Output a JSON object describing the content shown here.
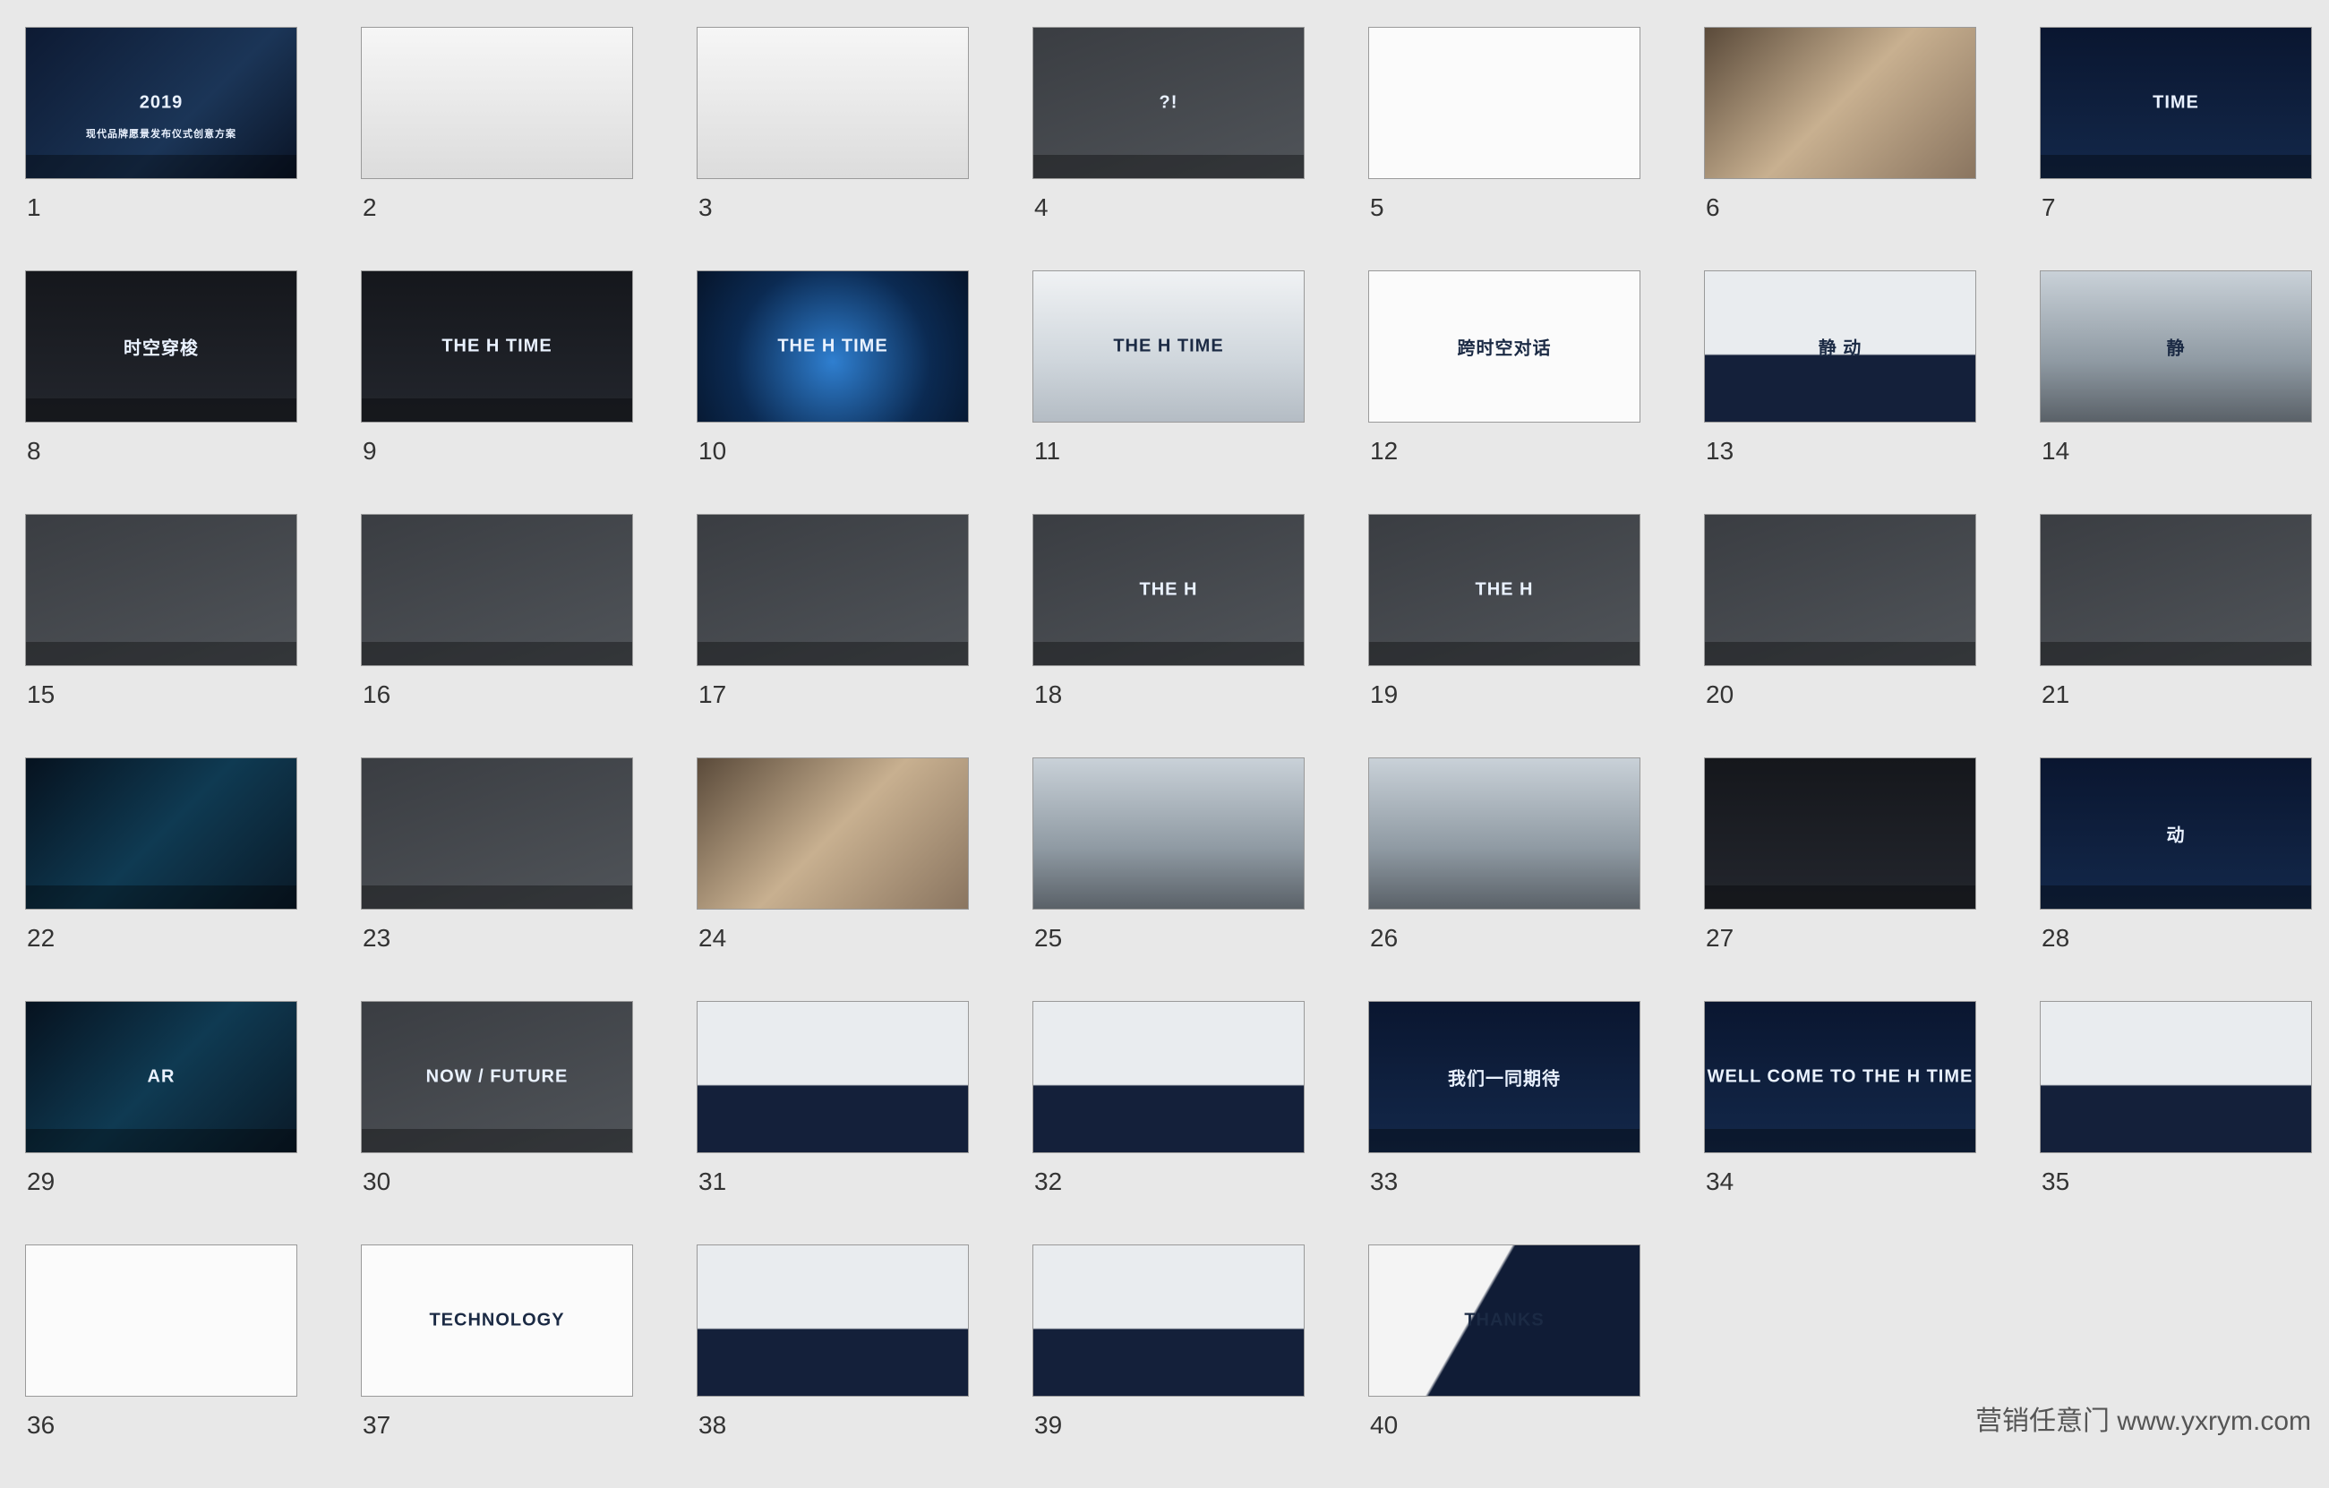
{
  "slides": [
    {
      "num": "1",
      "title": "2019",
      "subtitle": "现代品牌愿景发布仪式创意方案",
      "theme": "t-dark",
      "text_color": "light"
    },
    {
      "num": "2",
      "title": "",
      "theme": "t-light",
      "text_color": "dark"
    },
    {
      "num": "3",
      "title": "",
      "theme": "t-light",
      "text_color": "dark"
    },
    {
      "num": "4",
      "title": "?!",
      "theme": "t-gray",
      "text_color": "light"
    },
    {
      "num": "5",
      "title": "",
      "theme": "t-white",
      "text_color": "dark"
    },
    {
      "num": "6",
      "title": "",
      "theme": "t-warm",
      "text_color": "light"
    },
    {
      "num": "7",
      "title": "TIME",
      "theme": "t-navy",
      "text_color": "light"
    },
    {
      "num": "8",
      "title": "时空穿梭",
      "theme": "t-tunnel",
      "text_color": "light"
    },
    {
      "num": "9",
      "title": "THE H TIME",
      "theme": "t-tunnel",
      "text_color": "light"
    },
    {
      "num": "10",
      "title": "THE H TIME",
      "theme": "t-blue",
      "text_color": "light"
    },
    {
      "num": "11",
      "title": "THE H TIME",
      "theme": "t-sky",
      "text_color": "dark"
    },
    {
      "num": "12",
      "title": "跨时空对话",
      "theme": "t-white",
      "text_color": "dark"
    },
    {
      "num": "13",
      "title": "静 动",
      "theme": "t-wave",
      "text_color": "dark"
    },
    {
      "num": "14",
      "title": "静",
      "theme": "t-studio",
      "text_color": "dark"
    },
    {
      "num": "15",
      "title": "",
      "theme": "t-gray",
      "text_color": "light"
    },
    {
      "num": "16",
      "title": "",
      "theme": "t-gray",
      "text_color": "light"
    },
    {
      "num": "17",
      "title": "",
      "theme": "t-gray",
      "text_color": "light"
    },
    {
      "num": "18",
      "title": "THE H",
      "theme": "t-gray",
      "text_color": "light"
    },
    {
      "num": "19",
      "title": "THE H",
      "theme": "t-gray",
      "text_color": "light"
    },
    {
      "num": "20",
      "title": "",
      "theme": "t-gray",
      "text_color": "light"
    },
    {
      "num": "21",
      "title": "",
      "theme": "t-gray",
      "text_color": "light"
    },
    {
      "num": "22",
      "title": "",
      "theme": "t-cyan",
      "text_color": "light"
    },
    {
      "num": "23",
      "title": "",
      "theme": "t-gray",
      "text_color": "light"
    },
    {
      "num": "24",
      "title": "",
      "theme": "t-warm",
      "text_color": "light"
    },
    {
      "num": "25",
      "title": "",
      "theme": "t-studio",
      "text_color": "light"
    },
    {
      "num": "26",
      "title": "",
      "theme": "t-studio",
      "text_color": "light"
    },
    {
      "num": "27",
      "title": "",
      "theme": "t-tunnel",
      "text_color": "light"
    },
    {
      "num": "28",
      "title": "动",
      "theme": "t-navy",
      "text_color": "light"
    },
    {
      "num": "29",
      "title": "AR",
      "theme": "t-cyan",
      "text_color": "light"
    },
    {
      "num": "30",
      "title": "NOW / FUTURE",
      "theme": "t-gray",
      "text_color": "light"
    },
    {
      "num": "31",
      "title": "",
      "theme": "t-wave",
      "text_color": "dark"
    },
    {
      "num": "32",
      "title": "",
      "theme": "t-wave",
      "text_color": "dark"
    },
    {
      "num": "33",
      "title": "我们一同期待",
      "theme": "t-navy",
      "text_color": "light"
    },
    {
      "num": "34",
      "title": "WELL COME TO THE H TIME",
      "theme": "t-navy",
      "text_color": "light"
    },
    {
      "num": "35",
      "title": "",
      "theme": "t-wave",
      "text_color": "dark"
    },
    {
      "num": "36",
      "title": "",
      "theme": "t-white",
      "text_color": "dark"
    },
    {
      "num": "37",
      "title": "TECHNOLOGY",
      "theme": "t-white",
      "text_color": "dark"
    },
    {
      "num": "38",
      "title": "",
      "theme": "t-wave",
      "text_color": "dark"
    },
    {
      "num": "39",
      "title": "",
      "theme": "t-wave",
      "text_color": "dark"
    },
    {
      "num": "40",
      "title": "THANKS",
      "theme": "t-thanks",
      "text_color": "dark"
    }
  ],
  "watermark": "营销任意门 www.yxrym.com"
}
